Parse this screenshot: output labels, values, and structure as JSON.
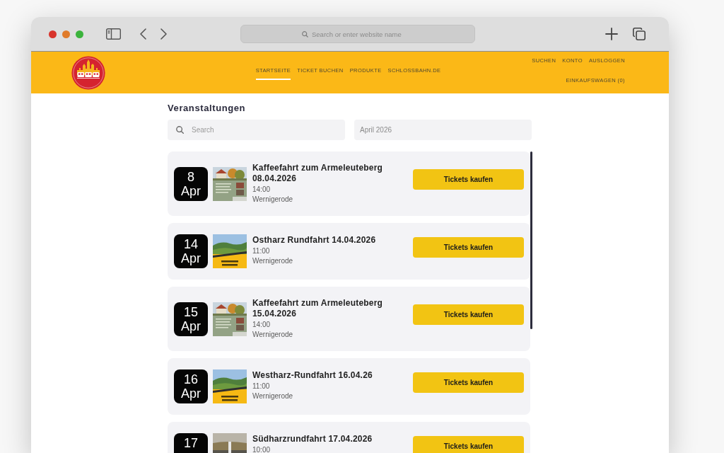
{
  "browser": {
    "address_bar": {
      "placeholder": "Search or enter website name"
    }
  },
  "header": {
    "nav": [
      {
        "label": "STARTSEITE",
        "selected": true
      },
      {
        "label": "TICKET BUCHEN",
        "selected": false
      },
      {
        "label": "PRODUKTE",
        "selected": false
      },
      {
        "label": "SCHLOSSBAHN.DE",
        "selected": false
      }
    ],
    "account_links": [
      "SUCHEN",
      "KONTO",
      "AUSLOGGEN"
    ],
    "cart": "EINKAUFSWAGEN (0)"
  },
  "page": {
    "title": "Veranstaltungen",
    "search": {
      "placeholder": "Search"
    },
    "month_filter": {
      "value": "April 2026"
    }
  },
  "events": [
    {
      "day": "8",
      "month": "Apr",
      "thumbnail": {
        "kind": "house"
      },
      "title": "Kaffeefahrt zum Armeleuteberg 08.04.2026",
      "time": "14:00",
      "location": "Wernigerode",
      "button": "Tickets kaufen"
    },
    {
      "day": "14",
      "month": "Apr",
      "thumbnail": {
        "kind": "landscape"
      },
      "title": "Ostharz Rundfahrt 14.04.2026",
      "time": "11:00",
      "location": "Wernigerode",
      "button": "Tickets kaufen"
    },
    {
      "day": "15",
      "month": "Apr",
      "thumbnail": {
        "kind": "house"
      },
      "title": "Kaffeefahrt zum Armeleuteberg 15.04.2026",
      "time": "14:00",
      "location": "Wernigerode",
      "button": "Tickets kaufen"
    },
    {
      "day": "16",
      "month": "Apr",
      "thumbnail": {
        "kind": "landscape"
      },
      "title": "Westharz-Rundfahrt 16.04.26",
      "time": "11:00",
      "location": "Wernigerode",
      "button": "Tickets kaufen"
    },
    {
      "day": "17",
      "thumbnail": {
        "kind": "photo"
      },
      "title": "Südharzrundfahrt 17.04.2026",
      "time": "10:00",
      "button": "Tickets kaufen"
    }
  ]
}
